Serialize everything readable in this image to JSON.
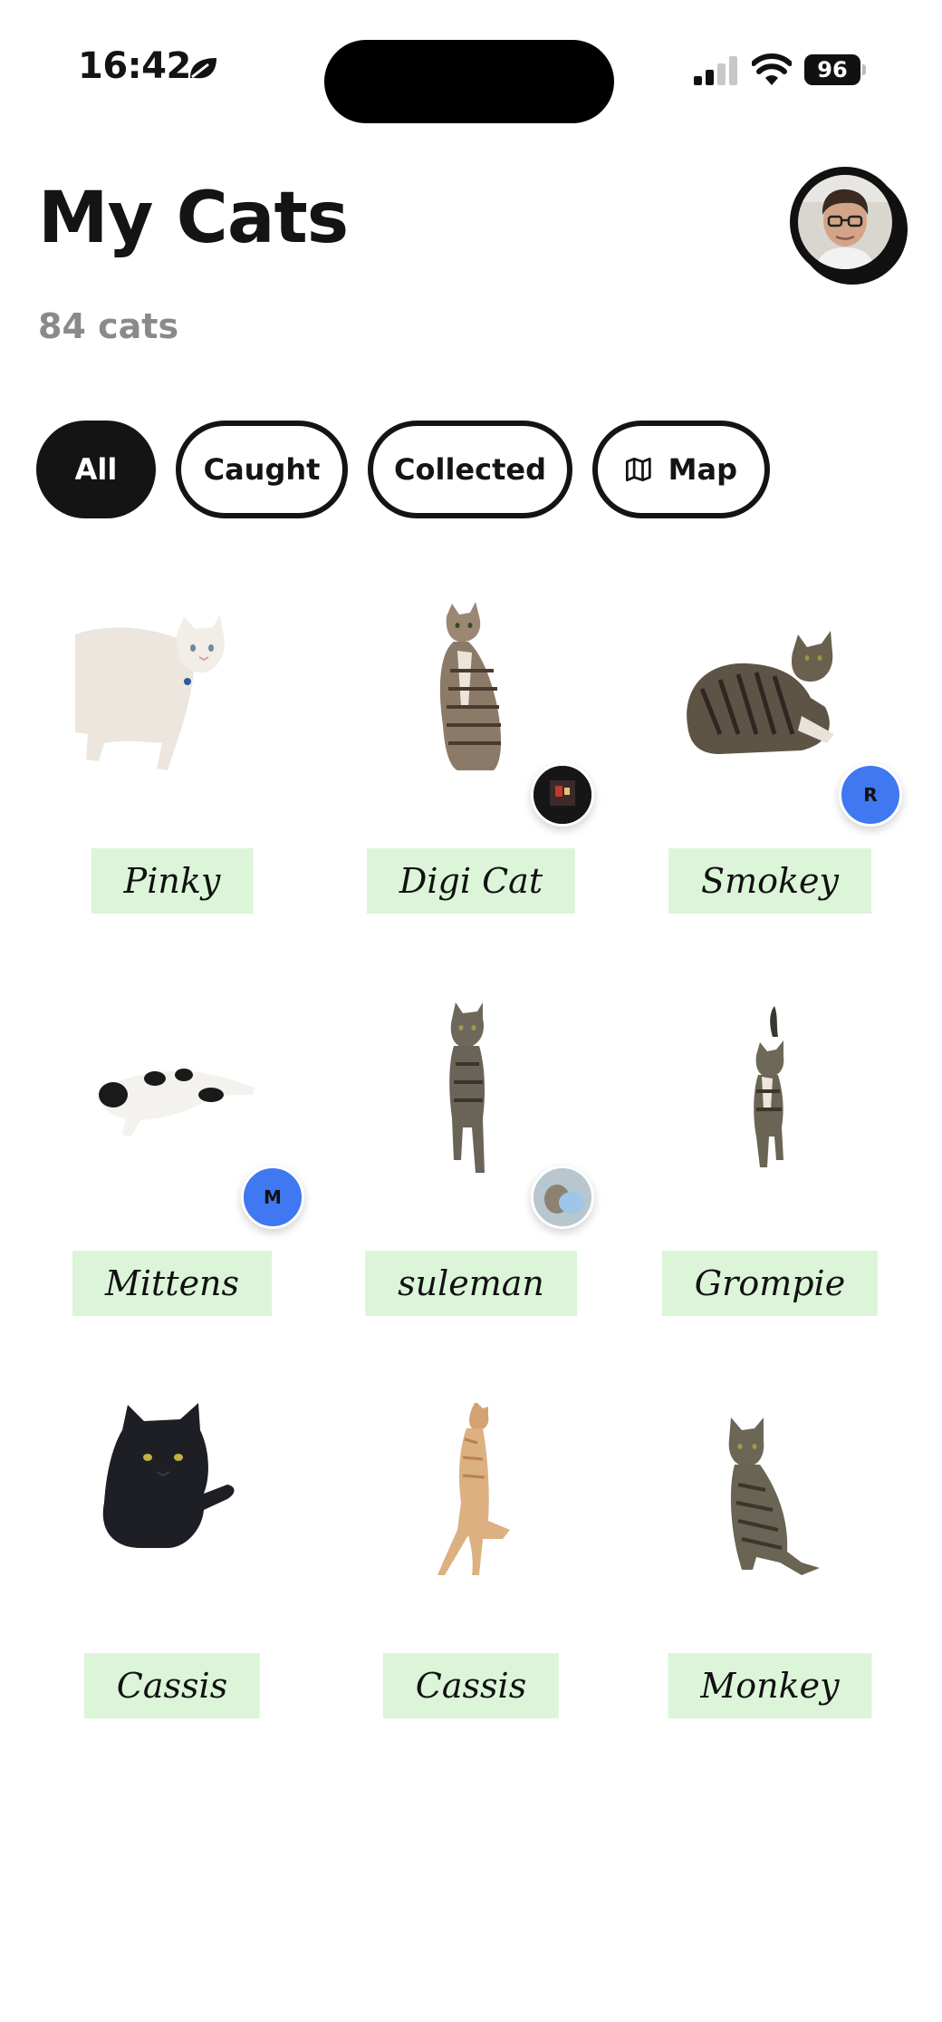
{
  "status_bar": {
    "time": "16:42",
    "battery": "96",
    "icons": [
      "leaf-icon",
      "signal-icon",
      "wifi-icon",
      "battery-icon"
    ]
  },
  "header": {
    "title": "My Cats",
    "count": "84 cats",
    "avatar_icon": "user-avatar"
  },
  "tabs": [
    {
      "label": "All",
      "active": true
    },
    {
      "label": "Caught",
      "active": false
    },
    {
      "label": "Collected",
      "active": false
    },
    {
      "label": "Map",
      "icon": "map-icon",
      "active": false
    }
  ],
  "cats": [
    {
      "name": "Pinky",
      "badge": null
    },
    {
      "name": "Digi Cat",
      "badge": {
        "type": "photo"
      }
    },
    {
      "name": "Smokey",
      "badge": {
        "type": "initial",
        "text": "R",
        "color": "#3f78f0"
      }
    },
    {
      "name": "Mittens",
      "badge": {
        "type": "initial",
        "text": "M",
        "color": "#3f78f0"
      }
    },
    {
      "name": "suleman",
      "badge": {
        "type": "photo"
      }
    },
    {
      "name": "Grompie",
      "badge": null
    },
    {
      "name": "Cassis",
      "badge": null
    },
    {
      "name": "Cassis",
      "badge": null
    },
    {
      "name": "Monkey",
      "badge": null
    }
  ],
  "colors": {
    "accent_dark": "#141414",
    "name_tag_bg": "#dcf5d9",
    "badge_blue": "#3f78f0",
    "muted_text": "#8a8a8a"
  }
}
